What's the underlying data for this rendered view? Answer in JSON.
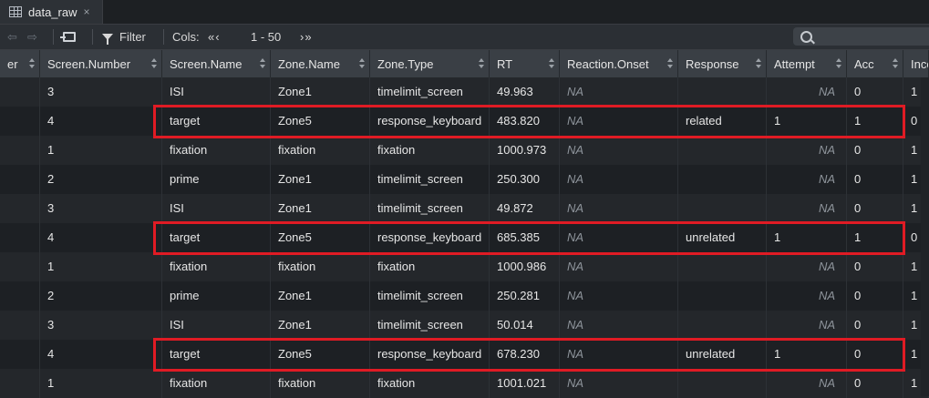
{
  "tab": {
    "title": "data_raw",
    "close": "×"
  },
  "toolbar": {
    "back": "⇦",
    "forward": "⇨",
    "filter_label": "Filter",
    "cols_label": "Cols:",
    "cols_prev": "«‹",
    "cols_range": "1 - 50",
    "cols_next": "›»"
  },
  "columns": [
    "er",
    "Screen.Number",
    "Screen.Name",
    "Zone.Name",
    "Zone.Type",
    "RT",
    "Reaction.Onset",
    "Response",
    "Attempt",
    "Acc",
    "Inco"
  ],
  "rows": [
    [
      "",
      "3",
      "ISI",
      "Zone1",
      "timelimit_screen",
      "49.963",
      "NA",
      "",
      "NA",
      "0",
      "1"
    ],
    [
      "",
      "4",
      "target",
      "Zone5",
      "response_keyboard",
      "483.820",
      "NA",
      "related",
      "1",
      "1",
      "0"
    ],
    [
      "",
      "1",
      "fixation",
      "fixation",
      "fixation",
      "1000.973",
      "NA",
      "",
      "NA",
      "0",
      "1"
    ],
    [
      "",
      "2",
      "prime",
      "Zone1",
      "timelimit_screen",
      "250.300",
      "NA",
      "",
      "NA",
      "0",
      "1"
    ],
    [
      "",
      "3",
      "ISI",
      "Zone1",
      "timelimit_screen",
      "49.872",
      "NA",
      "",
      "NA",
      "0",
      "1"
    ],
    [
      "",
      "4",
      "target",
      "Zone5",
      "response_keyboard",
      "685.385",
      "NA",
      "unrelated",
      "1",
      "1",
      "0"
    ],
    [
      "",
      "1",
      "fixation",
      "fixation",
      "fixation",
      "1000.986",
      "NA",
      "",
      "NA",
      "0",
      "1"
    ],
    [
      "",
      "2",
      "prime",
      "Zone1",
      "timelimit_screen",
      "250.281",
      "NA",
      "",
      "NA",
      "0",
      "1"
    ],
    [
      "",
      "3",
      "ISI",
      "Zone1",
      "timelimit_screen",
      "50.014",
      "NA",
      "",
      "NA",
      "0",
      "1"
    ],
    [
      "",
      "4",
      "target",
      "Zone5",
      "response_keyboard",
      "678.230",
      "NA",
      "unrelated",
      "1",
      "0",
      "1"
    ],
    [
      "",
      "1",
      "fixation",
      "fixation",
      "fixation",
      "1001.021",
      "NA",
      "",
      "NA",
      "0",
      "1"
    ]
  ],
  "highlighted_rows": [
    1,
    5,
    9
  ],
  "colors": {
    "highlight": "#e01b24"
  }
}
